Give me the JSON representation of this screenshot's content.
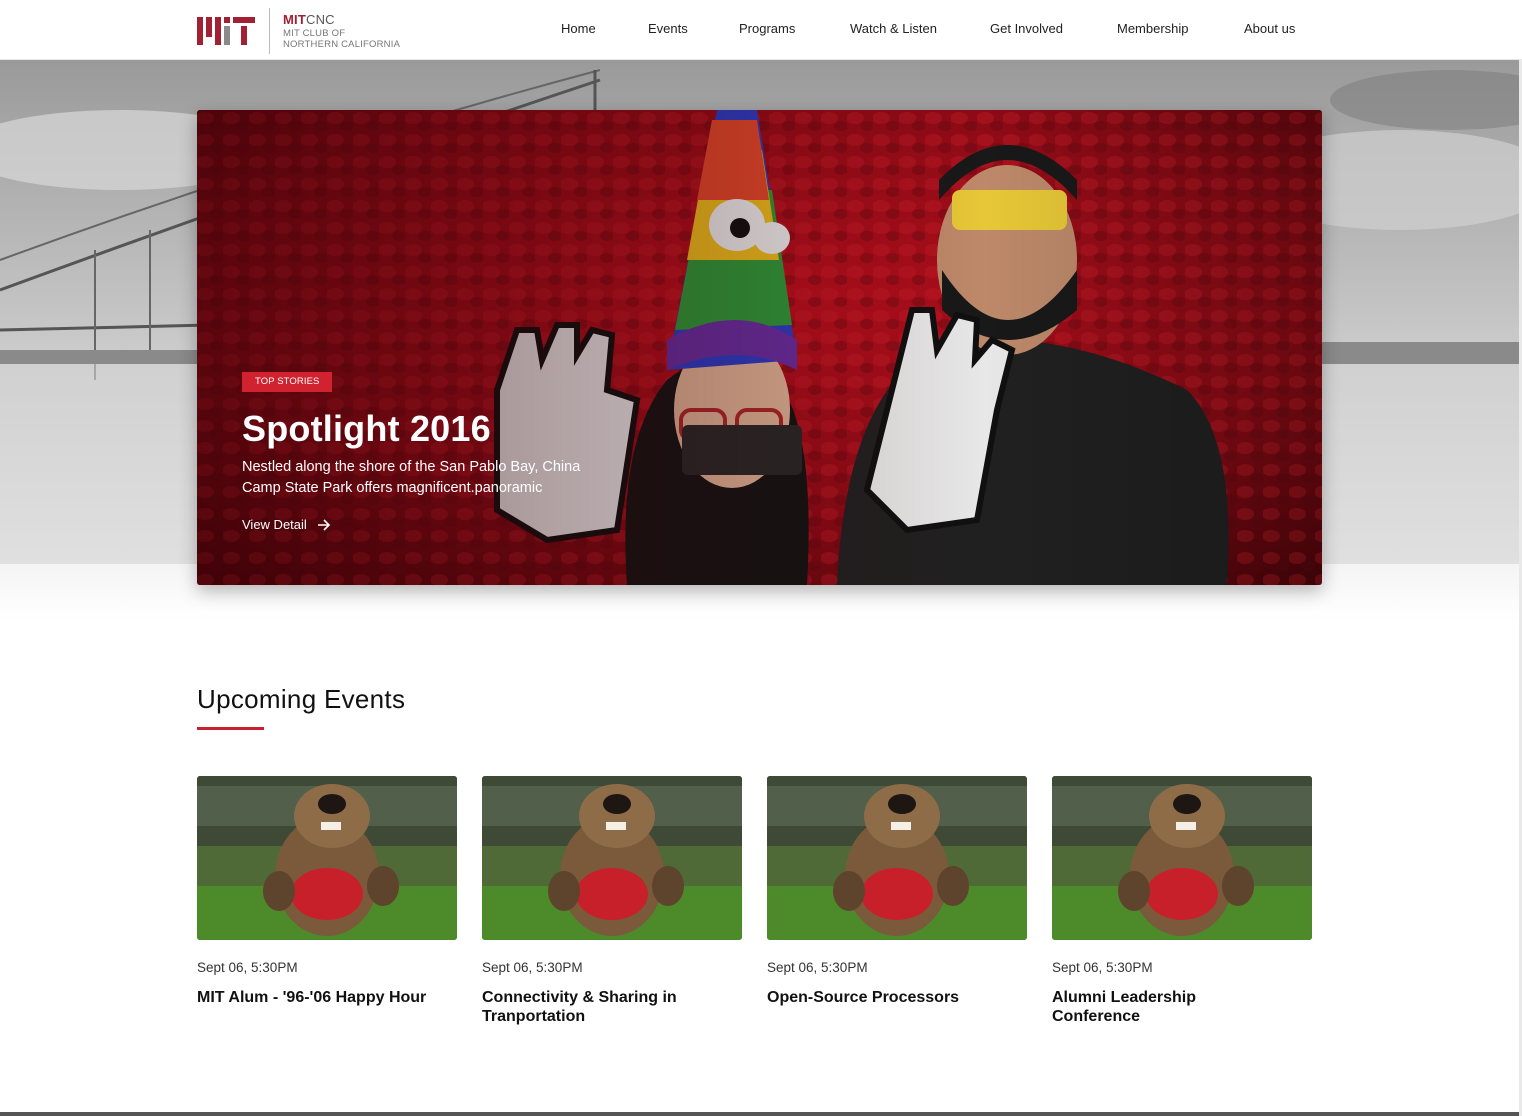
{
  "brand": {
    "title_bold": "MIT",
    "title_rest": "CNC",
    "subtitle_line1": "MIT CLUB OF",
    "subtitle_line2": "NORTHERN CALIFORNIA",
    "accent": "#a31f34"
  },
  "nav": [
    {
      "label": "Home"
    },
    {
      "label": "Events"
    },
    {
      "label": "Programs"
    },
    {
      "label": "Watch & Listen"
    },
    {
      "label": "Get Involved"
    },
    {
      "label": "Membership"
    },
    {
      "label": "About us"
    }
  ],
  "hero": {
    "badge": "TOP STORIES",
    "title": "Spotlight 2016",
    "description": "Nestled along the shore of the San Pablo Bay, China Camp State Park offers magnificent.panoramic",
    "link_label": "View Detail",
    "badge_color": "#d0222f"
  },
  "events": {
    "heading": "Upcoming Events",
    "items": [
      {
        "date": "Sept 06, 5:30PM",
        "title": "MIT Alum - '96-'06 Happy Hour"
      },
      {
        "date": "Sept 06, 5:30PM",
        "title": "Connectivity & Sharing in Tranportation"
      },
      {
        "date": "Sept 06, 5:30PM",
        "title": "Open-Source Processors"
      },
      {
        "date": "Sept 06, 5:30PM",
        "title": "Alumni Leadership Conference"
      }
    ]
  },
  "icons": {
    "hero_link": "arrow-right-icon",
    "event_image": "beaver-mascot-image"
  }
}
